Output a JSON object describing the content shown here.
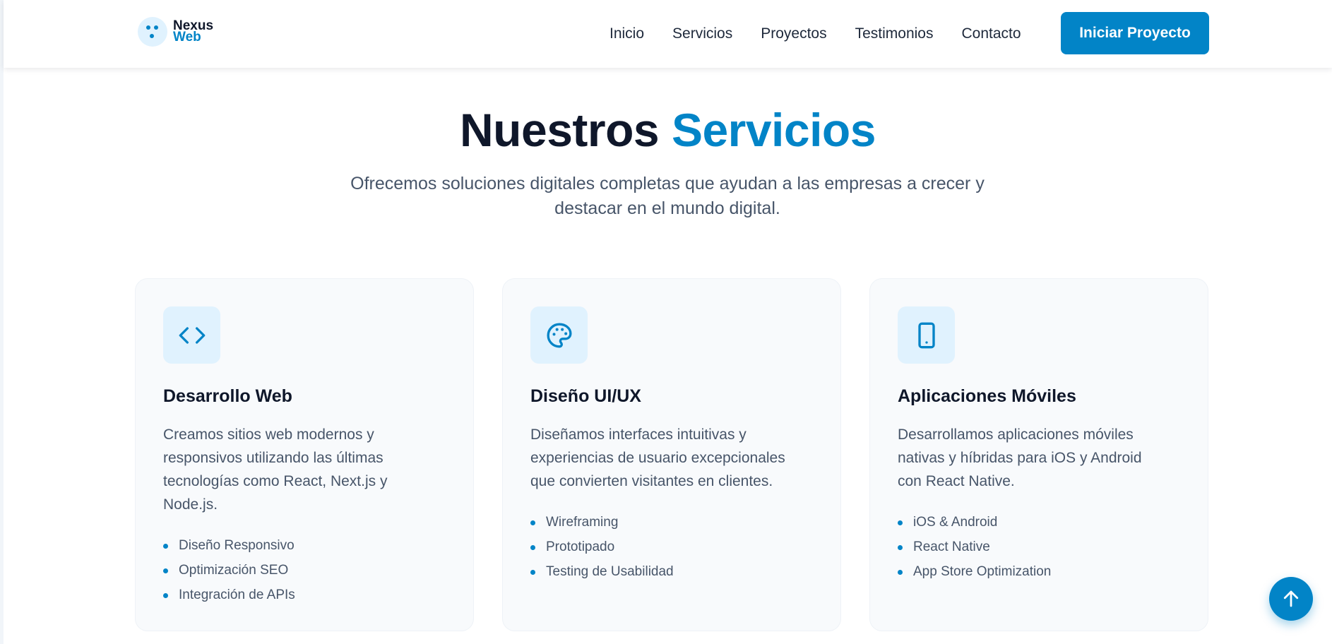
{
  "header": {
    "logo": {
      "line1": "Nexus",
      "line2": "Web"
    },
    "nav": [
      {
        "label": "Inicio"
      },
      {
        "label": "Servicios"
      },
      {
        "label": "Proyectos"
      },
      {
        "label": "Testimonios"
      },
      {
        "label": "Contacto"
      }
    ],
    "cta_label": "Iniciar Proyecto"
  },
  "section": {
    "title_part1": "Nuestros",
    "title_part2": "Servicios",
    "subtitle": "Ofrecemos soluciones digitales completas que ayudan a las empresas a crecer y destacar en el mundo digital."
  },
  "services": [
    {
      "icon": "code-icon",
      "title": "Desarrollo Web",
      "description": "Creamos sitios web modernos y responsivos utilizando las últimas tecnologías como React, Next.js y Node.js.",
      "features": [
        "Diseño Responsivo",
        "Optimización SEO",
        "Integración de APIs"
      ]
    },
    {
      "icon": "palette-icon",
      "title": "Diseño UI/UX",
      "description": "Diseñamos interfaces intuitivas y experiencias de usuario excepcionales que convierten visitantes en clientes.",
      "features": [
        "Wireframing",
        "Prototipado",
        "Testing de Usabilidad"
      ]
    },
    {
      "icon": "smartphone-icon",
      "title": "Aplicaciones Móviles",
      "description": "Desarrollamos aplicaciones móviles nativas y híbridas para iOS y Android con React Native.",
      "features": [
        "iOS & Android",
        "React Native",
        "App Store Optimization"
      ]
    }
  ],
  "scroll_top": {
    "icon": "arrow-up-icon"
  },
  "colors": {
    "accent": "#0284c7",
    "accent_light": "#e0f2fe",
    "heading": "#0f172a",
    "body_text": "#475569",
    "card_bg": "#f8fafc"
  }
}
